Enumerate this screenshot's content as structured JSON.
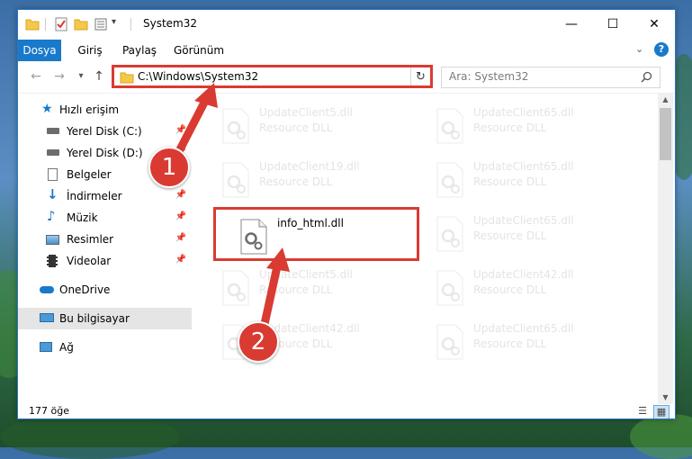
{
  "window": {
    "title": "System32",
    "minimize_icon": "minimize-icon",
    "maximize_icon": "maximize-icon",
    "close_icon": "close-icon"
  },
  "ribbon": {
    "tabs": [
      {
        "label": "Dosya",
        "active": true
      },
      {
        "label": "Giriş",
        "active": false
      },
      {
        "label": "Paylaş",
        "active": false
      },
      {
        "label": "Görünüm",
        "active": false
      }
    ]
  },
  "address": {
    "path": "C:\\Windows\\System32",
    "search_placeholder": "Ara: System32"
  },
  "nav": {
    "items": [
      {
        "label": "Hızlı erişim",
        "icon": "star-icon"
      },
      {
        "label": "Yerel Disk (C:)",
        "icon": "drive-icon"
      },
      {
        "label": "Yerel Disk (D:)",
        "icon": "drive-icon"
      },
      {
        "label": "Belgeler",
        "icon": "documents-icon"
      },
      {
        "label": "İndirmeler",
        "icon": "download-icon"
      },
      {
        "label": "Müzik",
        "icon": "music-icon"
      },
      {
        "label": "Resimler",
        "icon": "pictures-icon"
      },
      {
        "label": "Videolar",
        "icon": "video-icon"
      },
      {
        "label": "OneDrive",
        "icon": "cloud-icon"
      },
      {
        "label": "Bu bilgisayar",
        "icon": "computer-icon"
      },
      {
        "label": "Ağ",
        "icon": "network-icon"
      }
    ]
  },
  "files": [
    {
      "name": "UpdateClient5.dll",
      "desc": "Resource DLL"
    },
    {
      "name": "UpdateClient65.dll",
      "desc": "Resource DLL"
    },
    {
      "name": "UpdateClient19.dll",
      "desc": "Resource DLL"
    },
    {
      "name": "UpdateClient65.dll",
      "desc": "Resource DLL"
    },
    {
      "name": "info_html.dll",
      "desc": ""
    },
    {
      "name": "UpdateClient65.dll",
      "desc": "Resource DLL"
    },
    {
      "name": "UpdateClient5.dll",
      "desc": "Resource DLL"
    },
    {
      "name": "UpdateClient42.dll",
      "desc": "Resource DLL"
    },
    {
      "name": "UpdateClient42.dll",
      "desc": "Resource DLL"
    },
    {
      "name": "UpdateClient65.dll",
      "desc": "Resource DLL"
    }
  ],
  "status": {
    "count": "177 öğe"
  },
  "callouts": {
    "one": "1",
    "two": "2"
  },
  "colors": {
    "accent": "#1979ca",
    "highlight": "#d93b32"
  }
}
